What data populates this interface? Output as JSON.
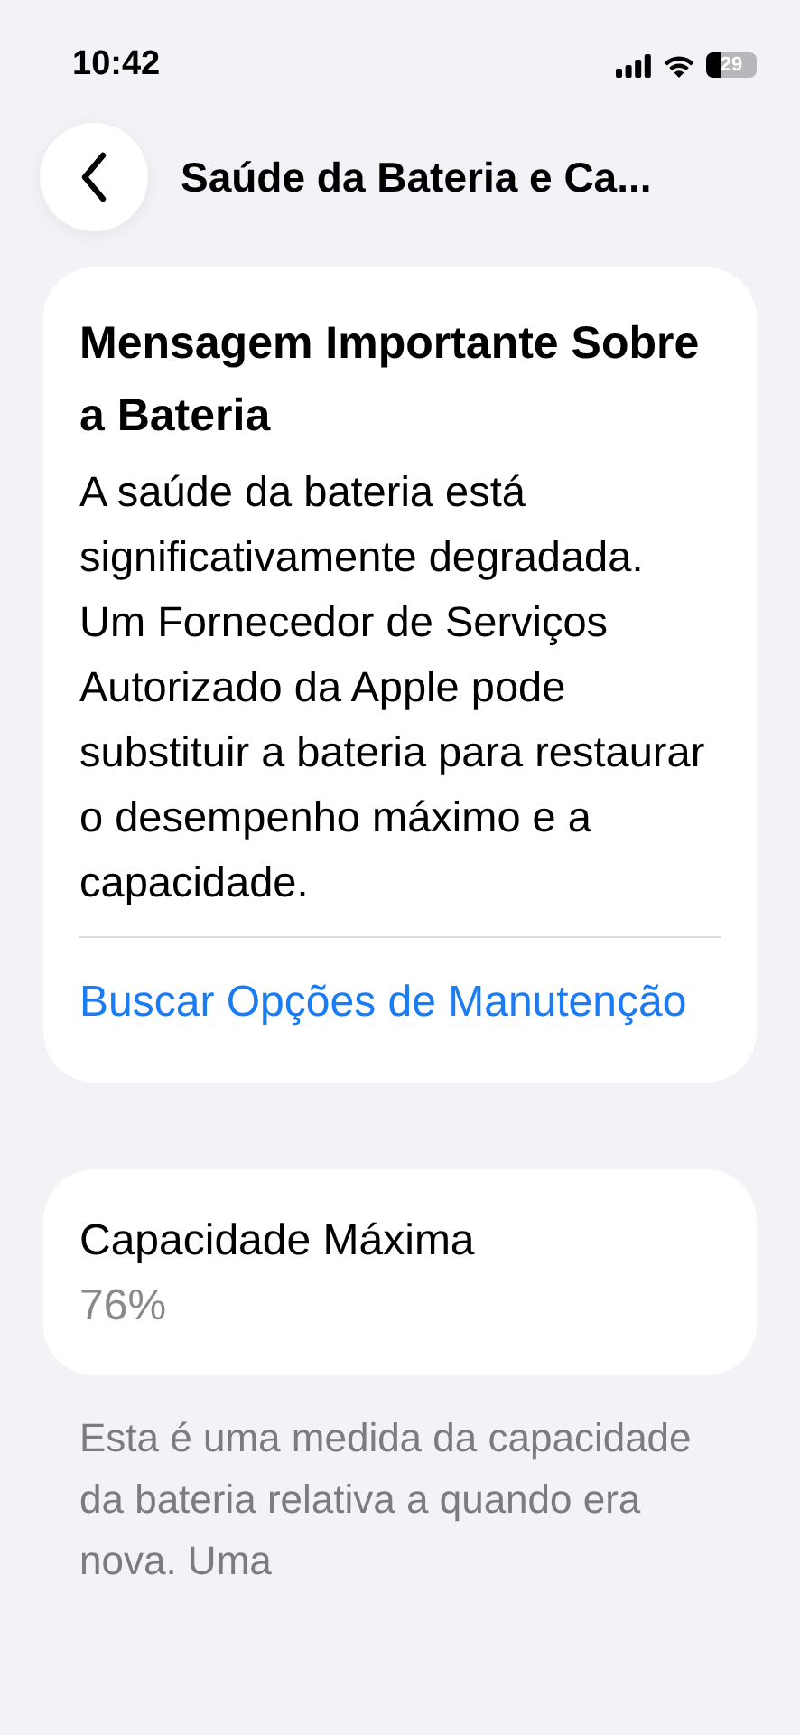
{
  "status_bar": {
    "time": "10:42",
    "battery": "29"
  },
  "header": {
    "title": "Saúde da Bateria e Ca..."
  },
  "message_card": {
    "title": "Mensagem Importante Sobre a Bateria",
    "body": "A saúde da bateria está significativamente degradada. Um Fornecedor de Serviços Autorizado da Apple pode substituir a bateria para restaurar o desempenho máximo e a capacidade.",
    "link": "Buscar Opções de Manutenção"
  },
  "capacity_card": {
    "label": "Capacidade Máxima",
    "value": "76%"
  },
  "footer": "Esta é uma medida da capacidade da bateria relativa a quando era nova. Uma"
}
